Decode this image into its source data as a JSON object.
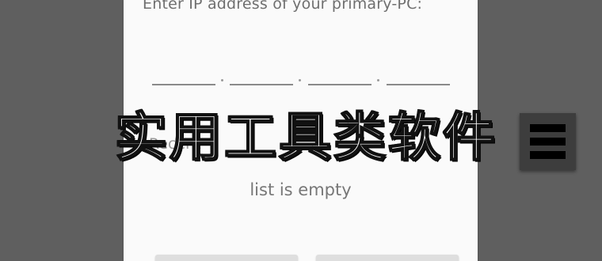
{
  "dialog": {
    "prompt": "Enter IP address of your primary-PC:",
    "recent_label": "Recent",
    "empty_text": "list is empty",
    "buttons": [
      "",
      ""
    ]
  },
  "overlay": {
    "watermark_text": "实用工具类软件"
  },
  "icons": {
    "menu": "hamburger-menu-icon"
  },
  "colors": {
    "backdrop": "#5f5f5f",
    "dialog": "#fafafa",
    "menu_button": "#3d3d3d"
  }
}
